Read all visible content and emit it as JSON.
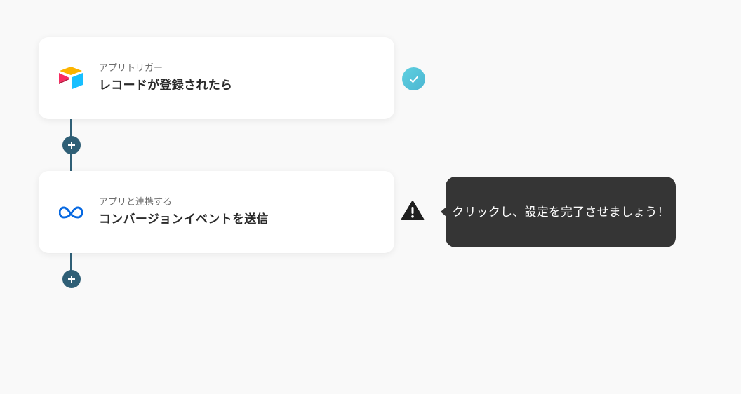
{
  "flow": {
    "steps": [
      {
        "subtitle": "アプリトリガー",
        "title": "レコードが登録されたら",
        "icon": "airtable-icon",
        "status": "complete"
      },
      {
        "subtitle": "アプリと連携する",
        "title": "コンバージョンイベントを送信",
        "icon": "meta-icon",
        "status": "warning"
      }
    ]
  },
  "tooltip": {
    "text": "クリックし、設定を完了させましょう！"
  },
  "colors": {
    "background": "#f9f9f9",
    "connector": "#2f5f76",
    "check": "#4bb6d2",
    "tooltip_bg": "#353535",
    "meta_blue": "#0668E1"
  }
}
